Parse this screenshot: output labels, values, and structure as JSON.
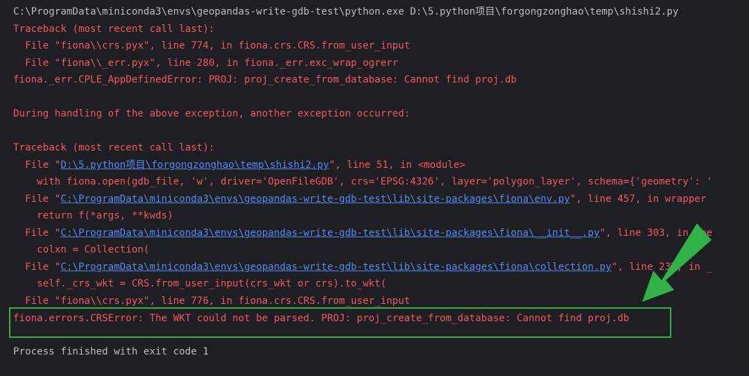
{
  "console": {
    "cmd_line": "C:\\ProgramData\\miniconda3\\envs\\geopandas-write-gdb-test\\python.exe D:\\5.python项目\\forgongzonghao\\temp\\shishi2.py",
    "tb1_header": "Traceback (most recent call last):",
    "tb1_frame1": "  File \"fiona\\\\crs.pyx\", line 774, in fiona.crs.CRS.from_user_input",
    "tb1_frame2": "  File \"fiona\\\\_err.pyx\", line 280, in fiona._err.exc_wrap_ogrerr",
    "tb1_error": "fiona._err.CPLE_AppDefinedError: PROJ: proj_create_from_database: Cannot find proj.db",
    "during_msg": "During handling of the above exception, another exception occurred:",
    "tb2_header": "Traceback (most recent call last):",
    "frame_a": {
      "prefix": "  File \"",
      "link": "D:\\5.python项目\\forgongzonghao\\temp\\shishi2.py",
      "suffix": "\", line 51, in <module>",
      "code": "    with fiona.open(gdb_file, 'w', driver='OpenFileGDB', crs='EPSG:4326', layer='polygon_layer', schema={'geometry': '"
    },
    "frame_b": {
      "prefix": "  File \"",
      "link": "C:\\ProgramData\\miniconda3\\envs\\geopandas-write-gdb-test\\lib\\site-packages\\fiona\\env.py",
      "suffix": "\", line 457, in wrapper",
      "code": "    return f(*args, **kwds)"
    },
    "frame_c": {
      "prefix": "  File \"",
      "link": "C:\\ProgramData\\miniconda3\\envs\\geopandas-write-gdb-test\\lib\\site-packages\\fiona\\__init__.py",
      "suffix": "\", line 303, in ope",
      "code": "    colxn = Collection("
    },
    "frame_d": {
      "prefix": "  File \"",
      "link": "C:\\ProgramData\\miniconda3\\envs\\geopandas-write-gdb-test\\lib\\site-packages\\fiona\\collection.py",
      "suffix": "\", line 232, in _",
      "code": "    self._crs_wkt = CRS.from_user_input(crs_wkt or crs).to_wkt("
    },
    "frame_e": "  File \"fiona\\\\crs.pyx\", line 776, in fiona.crs.CRS.from_user_input",
    "final_error": "fiona.errors.CRSError: The WKT could not be parsed. PROJ: proj_create_from_database: Cannot find proj.db",
    "exit_msg": "Process finished with exit code 1"
  },
  "colors": {
    "background": "#1e1f22",
    "command_text": "#bcbec4",
    "error_text": "#f75464",
    "link_text": "#548af7",
    "annotation_green": "#2fb344"
  }
}
